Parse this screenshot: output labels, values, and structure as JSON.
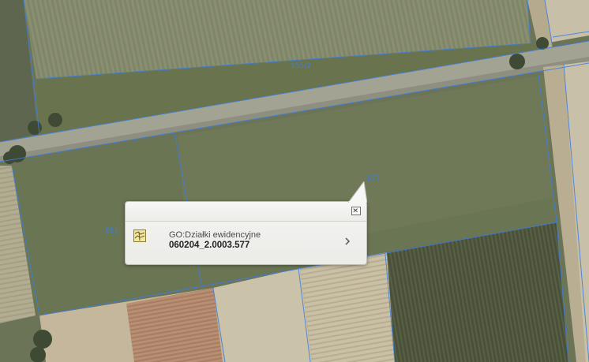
{
  "map": {
    "parcel_labels": [
      "155/2",
      "577",
      "651"
    ],
    "colors": {
      "parcel_boundary": "#3b7fe0",
      "road": "#a6a69a",
      "field": "#687453"
    }
  },
  "popup": {
    "layer_icon": "parcel-layer-icon",
    "layer_name": "GO:Działki ewidencyjne",
    "feature_id": "060204_2.0003.577",
    "close_icon": "close-icon",
    "next_icon": "chevron-right-icon"
  }
}
